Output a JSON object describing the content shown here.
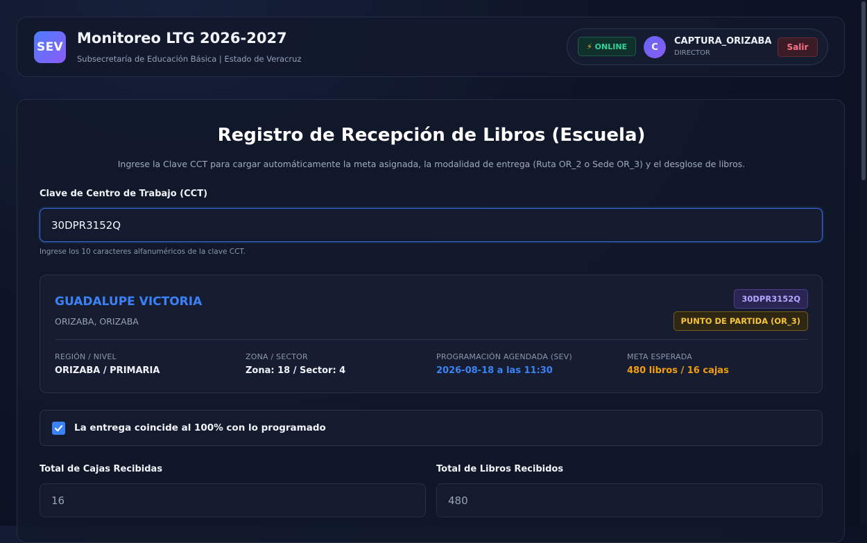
{
  "header": {
    "logo_text": "SEV",
    "title": "Monitoreo LTG 2026-2027",
    "subtitle": "Subsecretaría de Educación Básica | Estado de Veracruz",
    "status": "ONLINE",
    "avatar_initial": "C",
    "user_name": "CAPTURA_ORIZABA",
    "user_role": "DIRECTOR",
    "logout_label": "Salir"
  },
  "form": {
    "title": "Registro de Recepción de Libros (Escuela)",
    "subtitle": "Ingrese la Clave CCT para cargar automáticamente la meta asignada, la modalidad de entrega (Ruta OR_2 o Sede OR_3) y el desglose de libros.",
    "cct_label": "Clave de Centro de Trabajo (CCT)",
    "cct_value": "30DPR3152Q",
    "cct_hint": "Ingrese los 10 caracteres alfanuméricos de la clave CCT."
  },
  "school": {
    "name": "GUADALUPE VICTORIA",
    "location": "ORIZABA, ORIZABA",
    "cct_badge": "30DPR3152Q",
    "mode_badge": "PUNTO DE PARTIDA (OR_3)",
    "region_label": "REGIÓN / NIVEL",
    "region_value": "ORIZABA / PRIMARIA",
    "zone_label": "ZONA / SECTOR",
    "zone_value": "Zona: 18 / Sector: 4",
    "schedule_label": "PROGRAMACIÓN AGENDADA (SEV)",
    "schedule_value": "2026-08-18 a las 11:30",
    "goal_label": "META ESPERADA",
    "goal_value": "480 libros / 16 cajas"
  },
  "confirmation": {
    "checked": true,
    "label": "La entrega coincide al 100% con lo programado"
  },
  "totals": {
    "boxes_label": "Total de Cajas Recibidas",
    "boxes_value": "16",
    "books_label": "Total de Libros Recibidos",
    "books_value": "480"
  },
  "colors": {
    "accent_blue": "#3b82f6",
    "online_green": "#34d399",
    "warning_orange": "#f59e0b",
    "badge_purple": "#b4a7ff",
    "logout_red": "#fb7185"
  }
}
